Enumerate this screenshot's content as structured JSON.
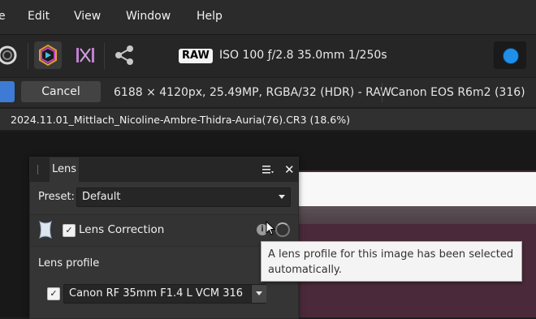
{
  "menubar": {
    "items": [
      {
        "label": "e"
      },
      {
        "label": "Edit"
      },
      {
        "label": "View"
      },
      {
        "label": "Window"
      },
      {
        "label": "Help"
      }
    ]
  },
  "toolbar": {
    "icons": [
      "ring-icon",
      "develop-persona-icon",
      "tone-map-icon",
      "share-icon"
    ],
    "raw_badge": "RAW",
    "exif": "ISO 100 ƒ/2.8 35.0mm 1/250s",
    "colors": {
      "accent_blue": "#1f8fe8"
    }
  },
  "contextbar": {
    "cancel_label": "Cancel",
    "image_info": "6188 × 4120px, 25.49MP, RGBA/32 (HDR) - RAW",
    "camera": "Canon EOS R6m2 (316)"
  },
  "document": {
    "title": "2024.11.01_Mittlach_Nicoline-Ambre-Thidra-Auria(76).CR3 (18.6%)"
  },
  "lens_panel": {
    "tab_label": "Lens",
    "preset_label": "Preset:",
    "preset_value": "Default",
    "lens_correction_label": "Lens Correction",
    "lens_correction_checked": true,
    "lens_profile_label": "Lens profile",
    "lens_profile_checked": true,
    "lens_profile_value": "Canon RF 35mm F1.4 L VCM 316",
    "check_glyph": "✓",
    "info_glyph": "i",
    "close_glyph": "✕"
  },
  "tooltip": {
    "text": "A lens profile for this image has been selected automatically."
  }
}
